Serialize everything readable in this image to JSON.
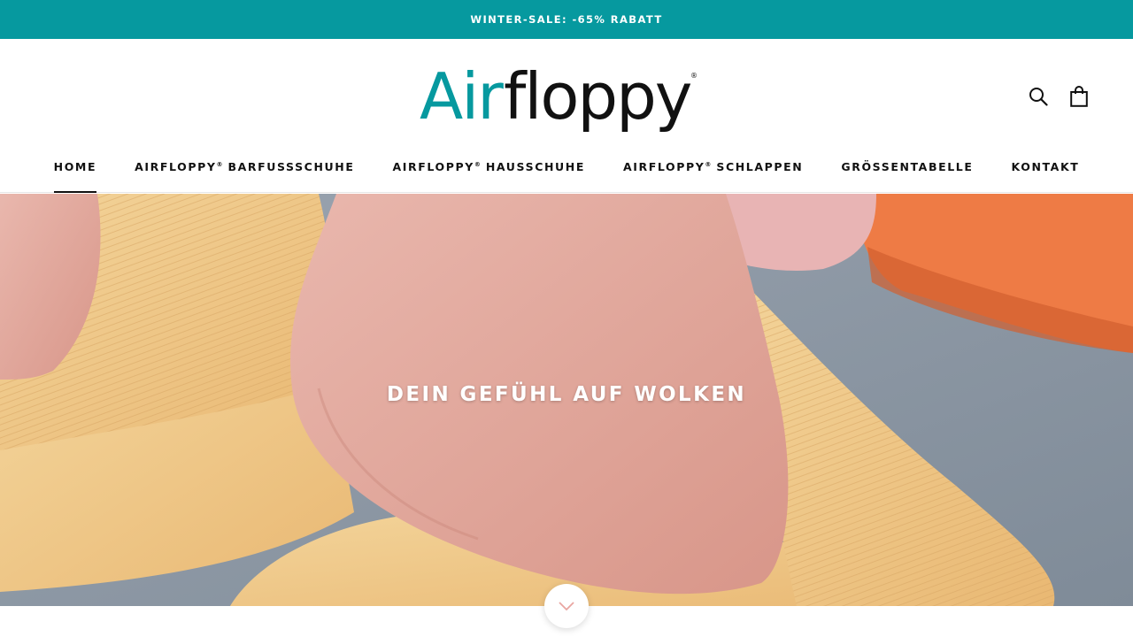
{
  "announcement": {
    "text": "WINTER-SALE: -65% RABATT"
  },
  "brand": {
    "name_part1": "Air",
    "name_part2": "floppy",
    "registered": "®",
    "accent_color": "#06999f"
  },
  "header": {
    "search_icon": "search-icon",
    "cart_icon": "shopping-bag-icon"
  },
  "nav": {
    "items": [
      {
        "label": "HOME",
        "active": true
      },
      {
        "label": "AIRFLOPPY",
        "suffix": " BARFUSSSCHUHE"
      },
      {
        "label": "AIRFLOPPY",
        "suffix": " HAUSSCHUHE"
      },
      {
        "label": "AIRFLOPPY",
        "suffix": " SCHLAPPEN"
      },
      {
        "label": "GRÖSSENTABELLE"
      },
      {
        "label": "KONTAKT"
      }
    ],
    "registered": "®"
  },
  "hero": {
    "title": "DEIN GEFÜHL AUF WOLKEN",
    "scroll_icon": "chevron-down-icon"
  }
}
